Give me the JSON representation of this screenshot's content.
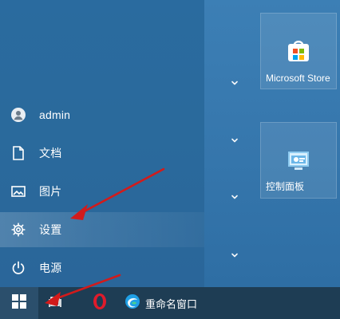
{
  "start_menu": {
    "items": [
      {
        "label": "admin",
        "icon": "user-icon"
      },
      {
        "label": "文档",
        "icon": "document-icon"
      },
      {
        "label": "图片",
        "icon": "picture-icon"
      },
      {
        "label": "设置",
        "icon": "gear-icon",
        "selected": true
      },
      {
        "label": "电源",
        "icon": "power-icon"
      }
    ]
  },
  "tiles": [
    {
      "label": "Microsoft Store",
      "icon": "store-icon"
    },
    {
      "label": "控制面板",
      "icon": "control-panel-icon"
    }
  ],
  "taskbar": {
    "start": {
      "icon": "windows-logo-icon"
    },
    "items": [
      {
        "icon": "task-view-icon",
        "label": ""
      },
      {
        "icon": "opera-icon",
        "label": ""
      },
      {
        "icon": "edge-icon",
        "label": "重命名窗口"
      }
    ]
  },
  "annotations": {
    "arrow_color": "#d21b1b"
  }
}
